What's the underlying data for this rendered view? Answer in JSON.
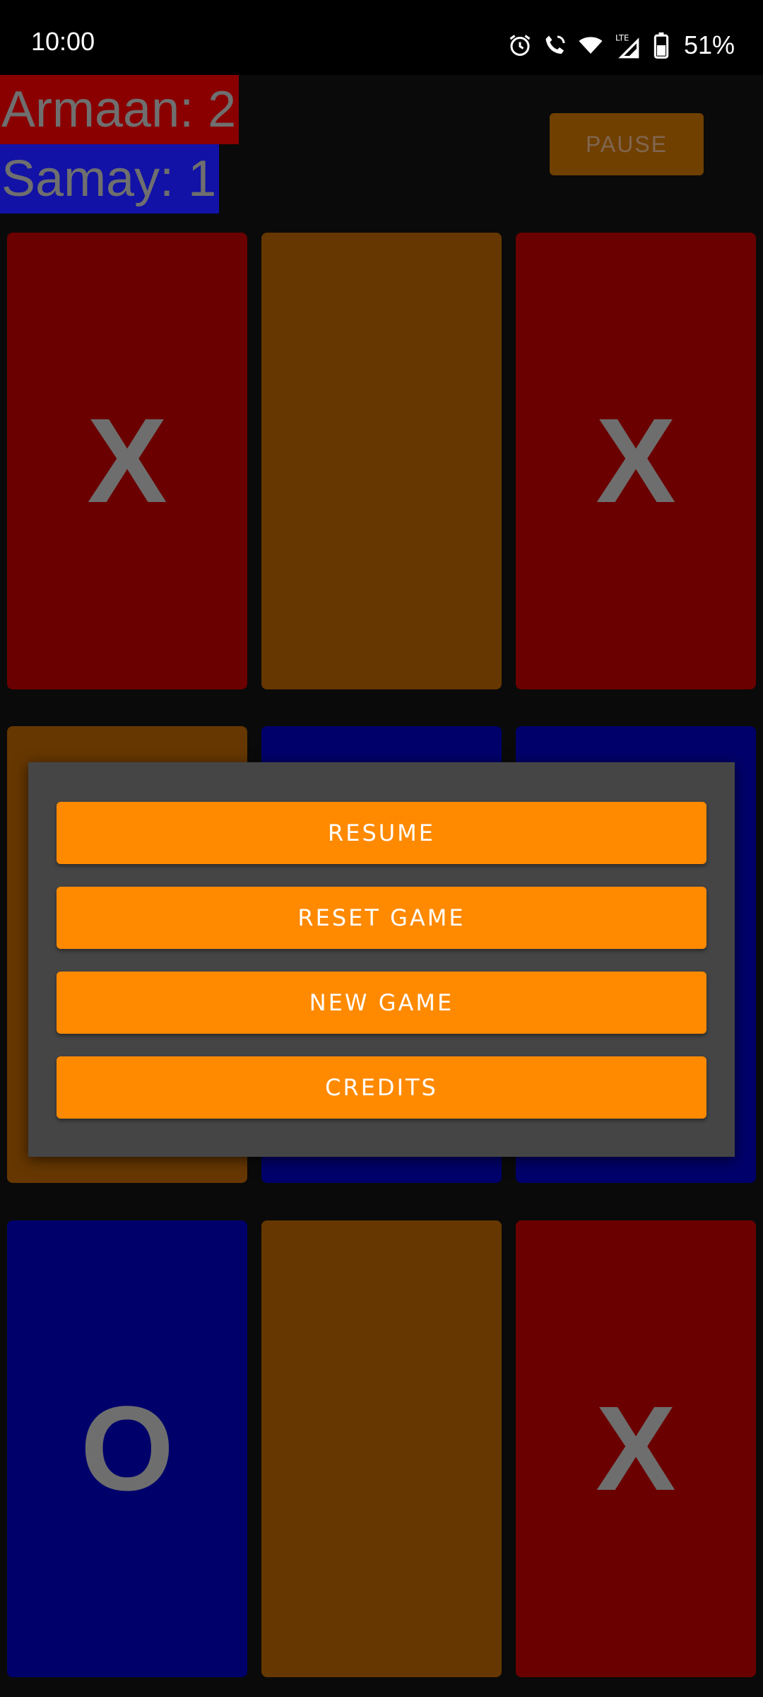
{
  "status_bar": {
    "time": "10:00",
    "icons": [
      "alarm-icon",
      "wifi-calling-icon",
      "wifi-icon",
      "lte-signal-icon",
      "battery-icon"
    ],
    "battery_percent": "51%"
  },
  "scores": {
    "player_one": "Armaan: 2",
    "player_two": "Samay: 1",
    "player_one_color": "#8a0000",
    "player_two_color": "#1212a6"
  },
  "pause_label": "PAUSE",
  "board": {
    "cells": [
      {
        "mark": "X",
        "color": "red"
      },
      {
        "mark": "",
        "color": "orange"
      },
      {
        "mark": "X",
        "color": "red"
      },
      {
        "mark": "",
        "color": "orange"
      },
      {
        "mark": "",
        "color": "blue"
      },
      {
        "mark": "",
        "color": "blue"
      },
      {
        "mark": "O",
        "color": "blue"
      },
      {
        "mark": "",
        "color": "orange"
      },
      {
        "mark": "X",
        "color": "red"
      }
    ]
  },
  "pause_menu": {
    "resume": "RESUME",
    "reset_game": "RESET GAME",
    "new_game": "NEW GAME",
    "credits": "CREDITS",
    "accent_color": "#ff8a00"
  }
}
